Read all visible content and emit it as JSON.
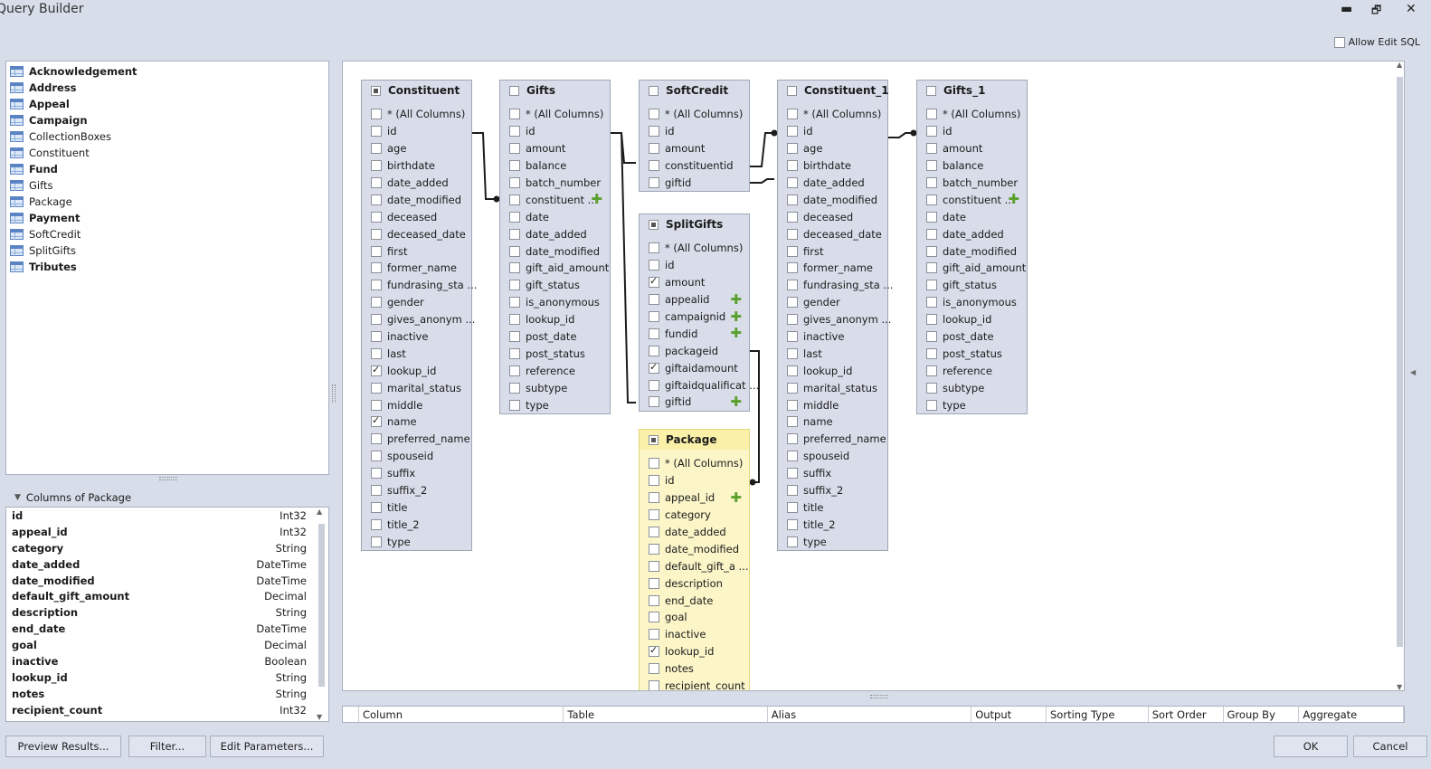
{
  "window": {
    "title": "Query Builder",
    "minimize": "▬",
    "restore": "🗗",
    "close": "✕"
  },
  "allow_edit_sql": "Allow Edit SQL",
  "tables_list": [
    {
      "label": "Acknowledgement",
      "bold": true
    },
    {
      "label": "Address",
      "bold": true
    },
    {
      "label": "Appeal",
      "bold": true
    },
    {
      "label": "Campaign",
      "bold": true
    },
    {
      "label": "CollectionBoxes",
      "bold": false
    },
    {
      "label": "Constituent",
      "bold": false
    },
    {
      "label": "Fund",
      "bold": true
    },
    {
      "label": "Gifts",
      "bold": false
    },
    {
      "label": "Package",
      "bold": false
    },
    {
      "label": "Payment",
      "bold": true
    },
    {
      "label": "SoftCredit",
      "bold": false
    },
    {
      "label": "SplitGifts",
      "bold": false
    },
    {
      "label": "Tributes",
      "bold": true
    }
  ],
  "columns_panel": {
    "header": "Columns of Package",
    "rows": [
      {
        "name": "id",
        "type": "Int32"
      },
      {
        "name": "appeal_id",
        "type": "Int32"
      },
      {
        "name": "category",
        "type": "String"
      },
      {
        "name": "date_added",
        "type": "DateTime"
      },
      {
        "name": "date_modified",
        "type": "DateTime"
      },
      {
        "name": "default_gift_amount",
        "type": "Decimal"
      },
      {
        "name": "description",
        "type": "String"
      },
      {
        "name": "end_date",
        "type": "DateTime"
      },
      {
        "name": "goal",
        "type": "Decimal"
      },
      {
        "name": "inactive",
        "type": "Boolean"
      },
      {
        "name": "lookup_id",
        "type": "String"
      },
      {
        "name": "notes",
        "type": "String"
      },
      {
        "name": "recipient_count",
        "type": "Int32"
      }
    ]
  },
  "query_tables": {
    "constituent": {
      "title": "Constituent",
      "fields": [
        {
          "l": "* (All Columns)"
        },
        {
          "l": "id"
        },
        {
          "l": "age"
        },
        {
          "l": "birthdate"
        },
        {
          "l": "date_added"
        },
        {
          "l": "date_modified"
        },
        {
          "l": "deceased"
        },
        {
          "l": "deceased_date"
        },
        {
          "l": "first"
        },
        {
          "l": "former_name"
        },
        {
          "l": "fundrasing_sta ..."
        },
        {
          "l": "gender"
        },
        {
          "l": "gives_anonym ..."
        },
        {
          "l": "inactive"
        },
        {
          "l": "last"
        },
        {
          "l": "lookup_id",
          "c": true
        },
        {
          "l": "marital_status"
        },
        {
          "l": "middle"
        },
        {
          "l": "name",
          "c": true
        },
        {
          "l": "preferred_name"
        },
        {
          "l": "spouseid"
        },
        {
          "l": "suffix"
        },
        {
          "l": "suffix_2"
        },
        {
          "l": "title"
        },
        {
          "l": "title_2"
        },
        {
          "l": "type"
        }
      ]
    },
    "gifts": {
      "title": "Gifts",
      "fields": [
        {
          "l": "* (All Columns)"
        },
        {
          "l": "id"
        },
        {
          "l": "amount"
        },
        {
          "l": "balance"
        },
        {
          "l": "batch_number"
        },
        {
          "l": "constituent ...",
          "p": true
        },
        {
          "l": "date"
        },
        {
          "l": "date_added"
        },
        {
          "l": "date_modified"
        },
        {
          "l": "gift_aid_amount"
        },
        {
          "l": "gift_status"
        },
        {
          "l": "is_anonymous"
        },
        {
          "l": "lookup_id"
        },
        {
          "l": "post_date"
        },
        {
          "l": "post_status"
        },
        {
          "l": "reference"
        },
        {
          "l": "subtype"
        },
        {
          "l": "type"
        }
      ]
    },
    "softcredit": {
      "title": "SoftCredit",
      "fields": [
        {
          "l": "* (All Columns)"
        },
        {
          "l": "id"
        },
        {
          "l": "amount"
        },
        {
          "l": "constituentid"
        },
        {
          "l": "giftid"
        }
      ]
    },
    "splitgifts": {
      "title": "SplitGifts",
      "fields": [
        {
          "l": "* (All Columns)"
        },
        {
          "l": "id"
        },
        {
          "l": "amount",
          "c": true
        },
        {
          "l": "appealid",
          "p": true
        },
        {
          "l": "campaignid",
          "p": true
        },
        {
          "l": "fundid",
          "p": true
        },
        {
          "l": "packageid"
        },
        {
          "l": "giftaidamount",
          "c": true
        },
        {
          "l": "giftaidqualificat ..."
        },
        {
          "l": "giftid",
          "p": true
        }
      ]
    },
    "package": {
      "title": "Package",
      "fields": [
        {
          "l": "* (All Columns)"
        },
        {
          "l": "id"
        },
        {
          "l": "appeal_id",
          "p": true
        },
        {
          "l": "category"
        },
        {
          "l": "date_added"
        },
        {
          "l": "date_modified"
        },
        {
          "l": "default_gift_a ..."
        },
        {
          "l": "description"
        },
        {
          "l": "end_date"
        },
        {
          "l": "goal"
        },
        {
          "l": "inactive"
        },
        {
          "l": "lookup_id",
          "c": true
        },
        {
          "l": "notes"
        },
        {
          "l": "recipient_count"
        }
      ]
    },
    "constituent_1": {
      "title": "Constituent_1",
      "fields": [
        {
          "l": "* (All Columns)"
        },
        {
          "l": "id"
        },
        {
          "l": "age"
        },
        {
          "l": "birthdate"
        },
        {
          "l": "date_added"
        },
        {
          "l": "date_modified"
        },
        {
          "l": "deceased"
        },
        {
          "l": "deceased_date"
        },
        {
          "l": "first"
        },
        {
          "l": "former_name"
        },
        {
          "l": "fundrasing_sta ..."
        },
        {
          "l": "gender"
        },
        {
          "l": "gives_anonym ..."
        },
        {
          "l": "inactive"
        },
        {
          "l": "last"
        },
        {
          "l": "lookup_id"
        },
        {
          "l": "marital_status"
        },
        {
          "l": "middle"
        },
        {
          "l": "name"
        },
        {
          "l": "preferred_name"
        },
        {
          "l": "spouseid"
        },
        {
          "l": "suffix"
        },
        {
          "l": "suffix_2"
        },
        {
          "l": "title"
        },
        {
          "l": "title_2"
        },
        {
          "l": "type"
        }
      ]
    },
    "gifts_1": {
      "title": "Gifts_1",
      "fields": [
        {
          "l": "* (All Columns)"
        },
        {
          "l": "id"
        },
        {
          "l": "amount"
        },
        {
          "l": "balance"
        },
        {
          "l": "batch_number"
        },
        {
          "l": "constituent ...",
          "p": true
        },
        {
          "l": "date"
        },
        {
          "l": "date_added"
        },
        {
          "l": "date_modified"
        },
        {
          "l": "gift_aid_amount"
        },
        {
          "l": "gift_status"
        },
        {
          "l": "is_anonymous"
        },
        {
          "l": "lookup_id"
        },
        {
          "l": "post_date"
        },
        {
          "l": "post_status"
        },
        {
          "l": "reference"
        },
        {
          "l": "subtype"
        },
        {
          "l": "type"
        }
      ]
    }
  },
  "grid_columns": [
    "Column",
    "Table",
    "Alias",
    "Output",
    "Sorting Type",
    "Sort Order",
    "Group By",
    "Aggregate"
  ],
  "buttons": {
    "preview": "Preview Results...",
    "filter": "Filter...",
    "edit_params": "Edit Parameters...",
    "ok": "OK",
    "cancel": "Cancel"
  }
}
